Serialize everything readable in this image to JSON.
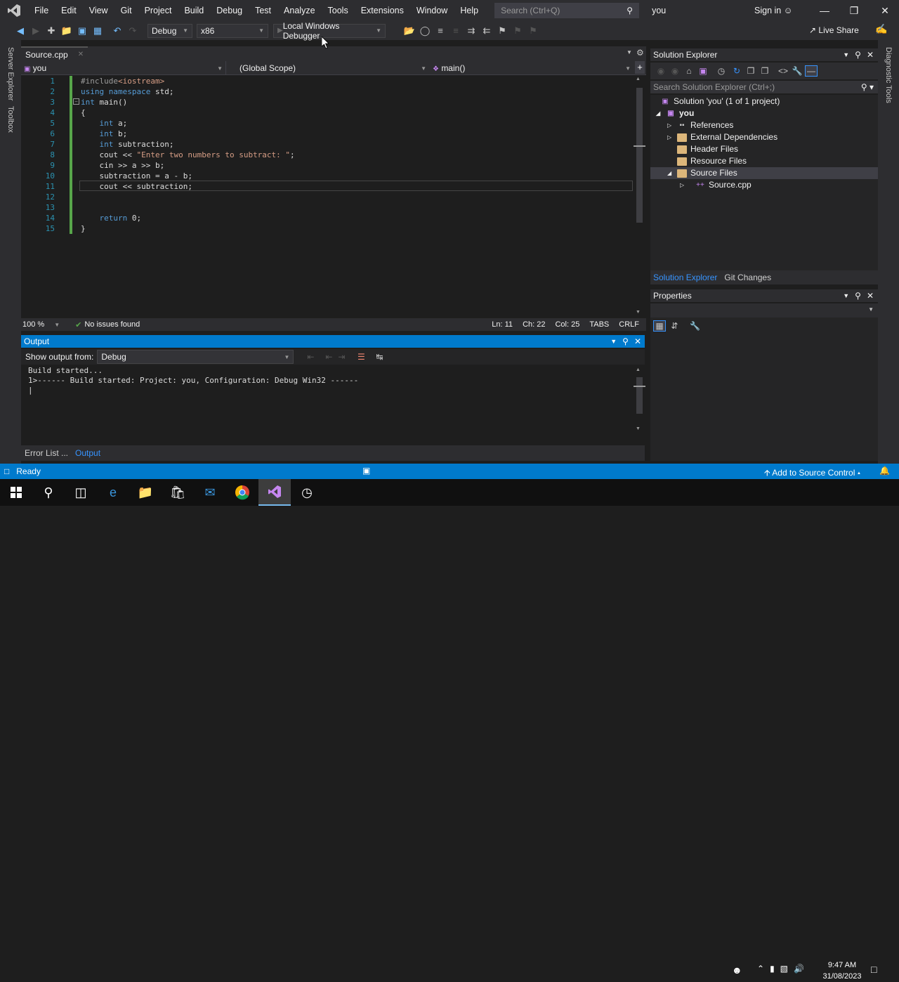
{
  "menubar": {
    "items": [
      "File",
      "Edit",
      "View",
      "Git",
      "Project",
      "Build",
      "Debug",
      "Test",
      "Analyze",
      "Tools",
      "Extensions",
      "Window",
      "Help"
    ],
    "search_placeholder": "Search (Ctrl+Q)",
    "solution_name": "you",
    "sign_in": "Sign in"
  },
  "toolbar": {
    "config": "Debug",
    "platform": "x86",
    "debugger": "Local Windows Debugger",
    "live_share": "Live Share"
  },
  "side_strips": {
    "left": [
      "Server Explorer",
      "Toolbox"
    ],
    "right": [
      "Diagnostic Tools"
    ]
  },
  "editor": {
    "tab_label": "Source.cpp",
    "nav_project": "you",
    "nav_scope": "(Global Scope)",
    "nav_member": "main()",
    "lines": [
      {
        "n": "1",
        "code": "#include<iostream>"
      },
      {
        "n": "2",
        "code": "using namespace std;"
      },
      {
        "n": "3",
        "code": "int main()"
      },
      {
        "n": "4",
        "code": "{"
      },
      {
        "n": "5",
        "code": "    int a;"
      },
      {
        "n": "6",
        "code": "    int b;"
      },
      {
        "n": "7",
        "code": "    int subtraction;"
      },
      {
        "n": "8",
        "code": "    cout << \"Enter two numbers to subtract: \";"
      },
      {
        "n": "9",
        "code": "    cin >> a >> b;"
      },
      {
        "n": "10",
        "code": "    subtraction = a - b;"
      },
      {
        "n": "11",
        "code": "    cout << subtraction;"
      },
      {
        "n": "12",
        "code": ""
      },
      {
        "n": "13",
        "code": ""
      },
      {
        "n": "14",
        "code": "    return 0;"
      },
      {
        "n": "15",
        "code": "}"
      }
    ],
    "status": {
      "zoom": "100 %",
      "issues": "No issues found",
      "line": "Ln: 11",
      "char": "Ch: 22",
      "col": "Col: 25",
      "tabs": "TABS",
      "eol": "CRLF"
    }
  },
  "output": {
    "title": "Output",
    "show_from_label": "Show output from:",
    "show_from_value": "Debug",
    "text": "Build started...\n1>------ Build started: Project: you, Configuration: Debug Win32 ------\n|"
  },
  "bottom_tabs": [
    "Error List ...",
    "Output"
  ],
  "solution_explorer": {
    "title": "Solution Explorer",
    "search_placeholder": "Search Solution Explorer (Ctrl+;)",
    "tree": [
      {
        "label": "Solution 'you' (1 of 1 project)",
        "icon": "solution-icon"
      },
      {
        "label": "you",
        "icon": "project-icon"
      },
      {
        "label": "References",
        "icon": "references-icon"
      },
      {
        "label": "External Dependencies",
        "icon": "folder-icon"
      },
      {
        "label": "Header Files",
        "icon": "folder-icon"
      },
      {
        "label": "Resource Files",
        "icon": "folder-icon"
      },
      {
        "label": "Source Files",
        "icon": "folder-icon"
      },
      {
        "label": "Source.cpp",
        "icon": "cpp-file-icon"
      }
    ],
    "tabs": [
      "Solution Explorer",
      "Git Changes"
    ]
  },
  "properties": {
    "title": "Properties"
  },
  "statusbar": {
    "ready": "Ready",
    "source_control": "Add to Source Control"
  },
  "taskbar": {
    "time": "9:47 AM",
    "date": "31/08/2023"
  },
  "colors": {
    "accent": "#007acc",
    "background": "#1e1e1e",
    "chrome": "#2d2d30"
  }
}
